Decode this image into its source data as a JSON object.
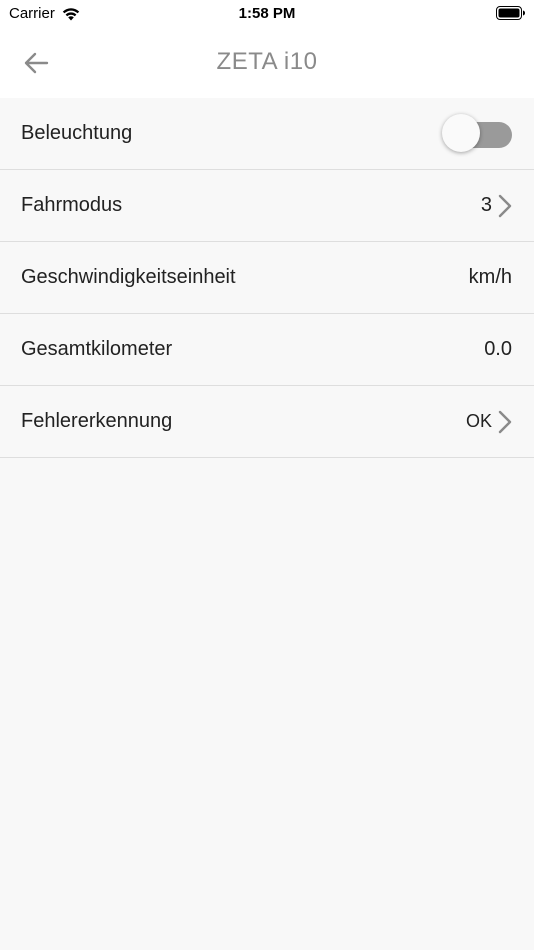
{
  "status_bar": {
    "carrier": "Carrier",
    "time": "1:58 PM",
    "icons": [
      "wifi-icon",
      "battery-icon"
    ]
  },
  "nav": {
    "title": "ZETA i10",
    "back_icon": "arrow-left-icon"
  },
  "settings": {
    "lighting": {
      "label": "Beleuchtung",
      "enabled": false
    },
    "drive_mode": {
      "label": "Fahrmodus",
      "value": "3"
    },
    "speed_unit": {
      "label": "Geschwindigkeitseinheit",
      "value": "km/h"
    },
    "total_km": {
      "label": "Gesamtkilometer",
      "value": "0.0"
    },
    "error_detection": {
      "label": "Fehlererkennung",
      "value": "OK"
    }
  },
  "colors": {
    "background": "#f8f8f8",
    "header_background": "#ffffff",
    "title": "#8a8a8a",
    "toggle_off_track": "#9a9a9a",
    "divider": "#dedede"
  }
}
